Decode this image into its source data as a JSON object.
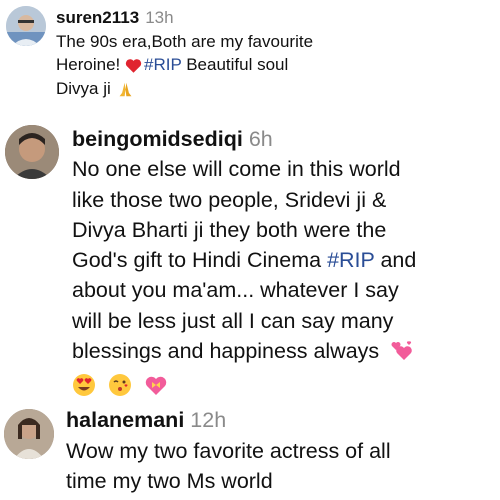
{
  "comments": [
    {
      "username": "suren2113",
      "time": "13h",
      "text_line1": "The 90s era,Both are my favourite",
      "text_line2_before": "Heroine!",
      "hashtag": "#RIP",
      "text_line2_after": " Beautiful soul",
      "text_line3": "Divya ji",
      "emojis": [
        "red-heart",
        "folded-hands"
      ]
    },
    {
      "username": "beingomidsediqi",
      "time": "6h",
      "line1": "No one else will come in this world",
      "line2": "like those two people, Sridevi ji &",
      "line3": "Divya Bharti ji they both were the",
      "line4_before": "God's gift to Hindi Cinema ",
      "hashtag": "#RIP",
      "line4_after": " and",
      "line5": "about you ma'am... whatever I say",
      "line6": "will be less just all I can say many",
      "line7": "blessings and happiness always",
      "emojis": [
        "revolving-hearts",
        "heart-eyes",
        "kissing-face",
        "heart-with-ribbon"
      ]
    },
    {
      "username": "halanemani",
      "time": "12h",
      "line1": "Wow my two favorite actress of all",
      "line2": "time my two Ms world"
    }
  ]
}
